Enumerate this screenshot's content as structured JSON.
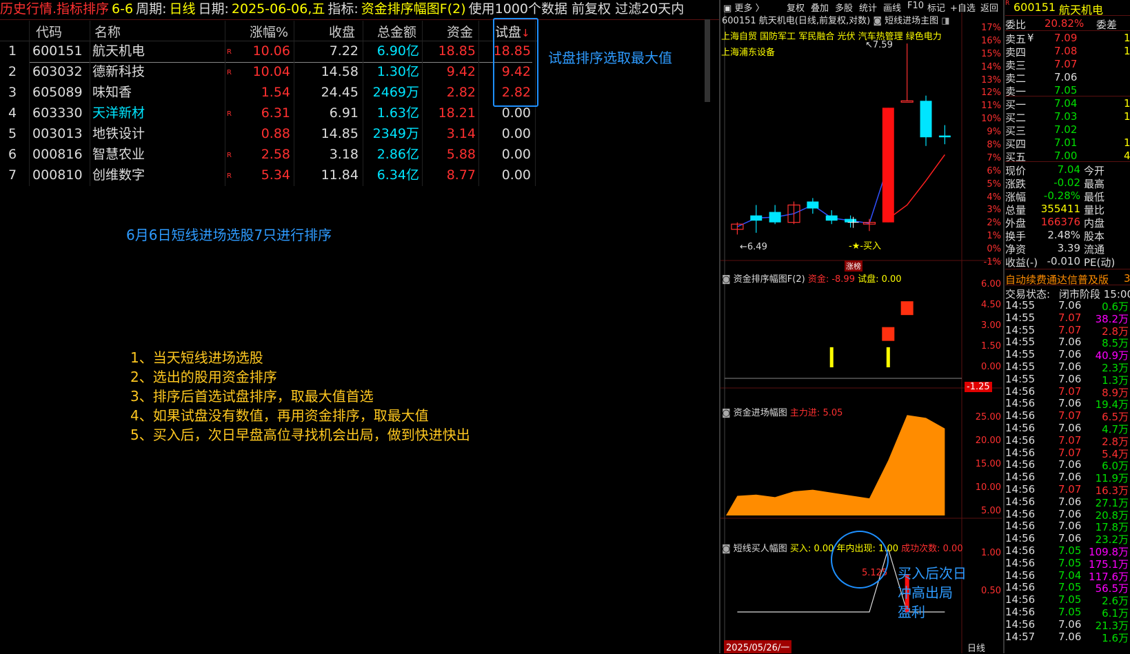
{
  "topbar": {
    "title": "历史行情.指标排序",
    "date_short": "6-6",
    "period_label": "周期:",
    "period_value": "日线",
    "date_label": "日期:",
    "date_value": "2025-06-06,五",
    "indicator_label": "指标:",
    "indicator_value": "资金排序幅图F(2)",
    "tail": "使用1000个数据 前复权 过滤20天内"
  },
  "table": {
    "headers": [
      "代码",
      "名称",
      "涨幅%",
      "收盘",
      "总金额",
      "资金",
      "试盘"
    ],
    "sort_arrow": "↓",
    "rows": [
      {
        "idx": "1",
        "code": "600151",
        "name": "航天机电",
        "r": "R",
        "chg": "10.06",
        "close": "7.22",
        "amt": "6.90亿",
        "fund": "18.85",
        "test": "18.85"
      },
      {
        "idx": "2",
        "code": "603032",
        "name": "德新科技",
        "r": "R",
        "chg": "10.04",
        "close": "14.58",
        "amt": "1.30亿",
        "fund": "9.42",
        "test": "9.42"
      },
      {
        "idx": "3",
        "code": "605089",
        "name": "味知香",
        "r": "",
        "chg": "1.54",
        "close": "24.45",
        "amt": "2469万",
        "fund": "2.82",
        "test": "2.82"
      },
      {
        "idx": "4",
        "code": "603330",
        "name": "天洋新材",
        "r": "R",
        "chg": "6.31",
        "close": "6.91",
        "amt": "1.63亿",
        "fund": "18.21",
        "test": "0.00"
      },
      {
        "idx": "5",
        "code": "003013",
        "name": "地铁设计",
        "r": "",
        "chg": "0.88",
        "close": "14.85",
        "amt": "2349万",
        "fund": "3.14",
        "test": "0.00"
      },
      {
        "idx": "6",
        "code": "000816",
        "name": "智慧农业",
        "r": "R",
        "chg": "2.58",
        "close": "3.18",
        "amt": "2.86亿",
        "fund": "5.88",
        "test": "0.00"
      },
      {
        "idx": "7",
        "code": "000810",
        "name": "创维数字",
        "r": "R",
        "chg": "5.34",
        "close": "11.84",
        "amt": "6.34亿",
        "fund": "8.77",
        "test": "0.00"
      }
    ]
  },
  "annotations": {
    "test_max": "试盘排序选取最大值",
    "june6": "6月6日短线进场选股7只进行排序",
    "steps": [
      "1、当天短线进场选股",
      "2、选出的股用资金排序",
      "3、排序后首选试盘排序，取最大值首选",
      "4、如果试盘没有数值，再用资金排序，取最大值",
      "5、买入后，次日早盘高位寻找机会出局，做到快进快出"
    ],
    "exit_note": [
      "买入后次日",
      "冲高出局",
      "盈利"
    ]
  },
  "chart_toolbar": {
    "items": [
      "更多",
      "复权",
      "叠加",
      "多股",
      "统计",
      "画线",
      "F10",
      "标记",
      "+自选",
      "返回"
    ]
  },
  "main_chart": {
    "title": "600151 航天机电(日线,前复权,对数)",
    "indicator": "短线进场主图",
    "tags_line1": [
      "上海自贸",
      "国防军工",
      "军民融合",
      "光伏",
      "汽车热管理",
      "绿色电力"
    ],
    "tags_line2": "上海浦东设备",
    "high_label": "7.59",
    "low_label": "6.49",
    "buy_label": "-★-买入",
    "zt_label": "涨榜",
    "pct_axis": [
      "17%",
      "16%",
      "15%",
      "14%",
      "13%",
      "12%",
      "11%",
      "10%",
      "9%",
      "8%",
      "7%",
      "6%",
      "5%",
      "4%",
      "3%",
      "2%",
      "1%",
      "0%",
      "-1%"
    ]
  },
  "chart_data": [
    {
      "type": "candlestick",
      "title": "600151 航天机电(日线,前复权,对数)",
      "candles": [
        {
          "o": 6.52,
          "h": 6.56,
          "l": 6.49,
          "c": 6.55
        },
        {
          "o": 6.6,
          "h": 6.66,
          "l": 6.5,
          "c": 6.57
        },
        {
          "o": 6.62,
          "h": 6.66,
          "l": 6.55,
          "c": 6.56
        },
        {
          "o": 6.56,
          "h": 6.68,
          "l": 6.55,
          "c": 6.66
        },
        {
          "o": 6.68,
          "h": 6.7,
          "l": 6.61,
          "c": 6.64
        },
        {
          "o": 6.6,
          "h": 6.63,
          "l": 6.55,
          "c": 6.57
        },
        {
          "o": 6.58,
          "h": 6.6,
          "l": 6.53,
          "c": 6.56
        },
        {
          "o": 6.55,
          "h": 6.58,
          "l": 6.51,
          "c": 6.56
        },
        {
          "o": 6.56,
          "h": 7.22,
          "l": 6.56,
          "c": 7.22
        },
        {
          "o": 7.26,
          "h": 7.59,
          "l": 7.26,
          "c": 7.26
        },
        {
          "o": 7.26,
          "h": 7.29,
          "l": 7.0,
          "c": 7.05
        },
        {
          "o": 7.06,
          "h": 7.12,
          "l": 7.01,
          "c": 7.05
        }
      ]
    },
    {
      "type": "bar",
      "title": "资金排序幅图F(2)",
      "series": [
        {
          "name": "资金",
          "values": [
            0,
            0,
            0,
            0,
            0,
            1.4,
            0,
            0,
            1.4,
            0,
            0,
            0
          ]
        },
        {
          "name": "试盘",
          "values": [
            0,
            0,
            0,
            0,
            0,
            0,
            0,
            0,
            2.8,
            4.6,
            0,
            0
          ]
        }
      ],
      "legend_values": {
        "资金": "-8.99",
        "试盘": "0.00"
      },
      "yticks": [
        "6.00",
        "4.50",
        "3.00",
        "1.50",
        "0.00"
      ],
      "current_marker": "-1.25",
      "ylim": [
        0,
        6
      ]
    },
    {
      "type": "area",
      "title": "资金进场幅图",
      "series": [
        {
          "name": "主力进",
          "values": [
            4.8,
            5.1,
            4.5,
            5.9,
            6.3,
            5.6,
            4.9,
            4.2,
            13.5,
            24.6,
            23.9,
            21.3
          ]
        }
      ],
      "legend_values": {
        "主力进": "5.05"
      },
      "yticks": [
        "25.00",
        "20.00",
        "15.00",
        "10.00",
        "5.00"
      ],
      "ylim": [
        0,
        27
      ]
    },
    {
      "type": "line",
      "title": "短线买人幅图",
      "series": [
        {
          "name": "买入",
          "values": [
            0,
            0,
            0,
            0,
            0,
            0,
            0,
            0,
            1,
            0,
            0,
            0
          ]
        }
      ],
      "legend_values": {
        "买入": "0.00",
        "年内出现": "1.00",
        "成功次数": "0.00"
      },
      "annotation": "5.125",
      "yticks": [
        "1.00",
        "0.50"
      ],
      "date_label": "2025/05/26/一",
      "axis_label": "日线",
      "ylim": [
        0,
        1.2
      ]
    }
  ],
  "quote": {
    "code": "600151",
    "name": "航天机电",
    "weibi_label": "委比",
    "weibi": "20.82%",
    "weicha_label": "委差",
    "sells": [
      {
        "label": "卖五",
        "flag": "¥",
        "price": "7.09",
        "vol": "1"
      },
      {
        "label": "卖四",
        "flag": "",
        "price": "7.08",
        "vol": "1"
      },
      {
        "label": "卖三",
        "flag": "",
        "price": "7.07",
        "vol": ""
      },
      {
        "label": "卖二",
        "flag": "",
        "price": "7.06",
        "vol": ""
      },
      {
        "label": "卖一",
        "flag": "",
        "price": "7.05",
        "vol": ""
      }
    ],
    "buys": [
      {
        "label": "买一",
        "price": "7.04",
        "vol": "1"
      },
      {
        "label": "买二",
        "price": "7.03",
        "vol": "1"
      },
      {
        "label": "买三",
        "price": "7.02",
        "vol": ""
      },
      {
        "label": "买四",
        "price": "7.01",
        "vol": "1"
      },
      {
        "label": "买五",
        "price": "7.00",
        "vol": "4"
      }
    ],
    "stats": [
      {
        "l": "现价",
        "v": "7.04",
        "l2": "今开",
        "c": "#00e000"
      },
      {
        "l": "涨跌",
        "v": "-0.02",
        "l2": "最高",
        "c": "#00e000"
      },
      {
        "l": "涨幅",
        "v": "-0.28%",
        "l2": "最低",
        "c": "#00e000"
      },
      {
        "l": "总量",
        "v": "355411",
        "l2": "量比",
        "c": "#ffff00"
      },
      {
        "l": "外盘",
        "v": "166376",
        "l2": "内盘",
        "c": "#ff3030"
      },
      {
        "l": "换手",
        "v": "2.48%",
        "l2": "股本",
        "c": "#ddd"
      },
      {
        "l": "净资",
        "v": "3.39",
        "l2": "流通",
        "c": "#ddd"
      },
      {
        "l": "收益(-)",
        "v": "-0.010",
        "l2": "PE(动)",
        "c": "#ddd"
      }
    ],
    "ad_text": "自动续费通达信普及版",
    "ad_tail": "3",
    "status_label": "交易状态:",
    "status_value": "闭市阶段 15:00"
  },
  "ticks": [
    {
      "t": "14:55",
      "p": "7.06",
      "v": "0.6万",
      "pc": "w",
      "vc": "g"
    },
    {
      "t": "14:55",
      "p": "7.07",
      "v": "38.2万",
      "pc": "r",
      "vc": "m"
    },
    {
      "t": "14:55",
      "p": "7.07",
      "v": "2.8万",
      "pc": "r",
      "vc": "r"
    },
    {
      "t": "14:55",
      "p": "7.06",
      "v": "8.5万",
      "pc": "w",
      "vc": "g"
    },
    {
      "t": "14:55",
      "p": "7.06",
      "v": "40.9万",
      "pc": "w",
      "vc": "m"
    },
    {
      "t": "14:55",
      "p": "7.06",
      "v": "2.3万",
      "pc": "w",
      "vc": "g"
    },
    {
      "t": "14:55",
      "p": "7.06",
      "v": "1.3万",
      "pc": "w",
      "vc": "g"
    },
    {
      "t": "14:56",
      "p": "7.07",
      "v": "8.9万",
      "pc": "r",
      "vc": "r"
    },
    {
      "t": "14:56",
      "p": "7.06",
      "v": "19.4万",
      "pc": "w",
      "vc": "g"
    },
    {
      "t": "14:56",
      "p": "7.07",
      "v": "6.5万",
      "pc": "r",
      "vc": "r"
    },
    {
      "t": "14:56",
      "p": "7.06",
      "v": "4.7万",
      "pc": "w",
      "vc": "g"
    },
    {
      "t": "14:56",
      "p": "7.07",
      "v": "2.8万",
      "pc": "r",
      "vc": "r"
    },
    {
      "t": "14:56",
      "p": "7.07",
      "v": "5.4万",
      "pc": "r",
      "vc": "r"
    },
    {
      "t": "14:56",
      "p": "7.06",
      "v": "6.0万",
      "pc": "w",
      "vc": "g"
    },
    {
      "t": "14:56",
      "p": "7.06",
      "v": "11.9万",
      "pc": "w",
      "vc": "g"
    },
    {
      "t": "14:56",
      "p": "7.07",
      "v": "16.3万",
      "pc": "r",
      "vc": "r"
    },
    {
      "t": "14:56",
      "p": "7.06",
      "v": "27.1万",
      "pc": "w",
      "vc": "g"
    },
    {
      "t": "14:56",
      "p": "7.06",
      "v": "20.8万",
      "pc": "w",
      "vc": "g"
    },
    {
      "t": "14:56",
      "p": "7.06",
      "v": "17.8万",
      "pc": "w",
      "vc": "g"
    },
    {
      "t": "14:56",
      "p": "7.06",
      "v": "23.2万",
      "pc": "w",
      "vc": "g"
    },
    {
      "t": "14:56",
      "p": "7.05",
      "v": "109.8万",
      "pc": "g",
      "vc": "m"
    },
    {
      "t": "14:56",
      "p": "7.05",
      "v": "175.1万",
      "pc": "g",
      "vc": "m"
    },
    {
      "t": "14:56",
      "p": "7.04",
      "v": "117.6万",
      "pc": "g",
      "vc": "m"
    },
    {
      "t": "14:56",
      "p": "7.05",
      "v": "56.5万",
      "pc": "g",
      "vc": "m"
    },
    {
      "t": "14:56",
      "p": "7.05",
      "v": "2.6万",
      "pc": "g",
      "vc": "g"
    },
    {
      "t": "14:56",
      "p": "7.05",
      "v": "6.1万",
      "pc": "g",
      "vc": "g"
    },
    {
      "t": "14:56",
      "p": "7.06",
      "v": "21.3万",
      "pc": "w",
      "vc": "g"
    },
    {
      "t": "14:57",
      "p": "7.06",
      "v": "1.6万",
      "pc": "w",
      "vc": "g"
    }
  ]
}
